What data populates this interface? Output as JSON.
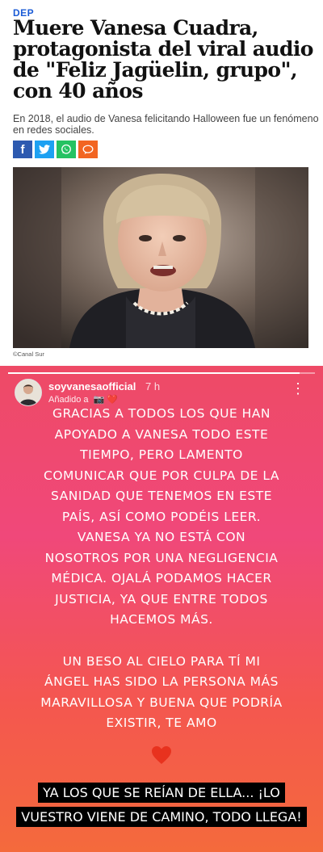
{
  "article": {
    "kicker": "DEP",
    "headline": "Muere Vanesa Cuadra, protagonista del viral audio de \"Feliz Jagüelin, grupo\", con 40 años",
    "subtitle": "En 2018, el audio de Vanesa felicitando Halloween fue un fenómeno en redes sociales.",
    "share_buttons": [
      {
        "icon": "facebook-icon",
        "glyph": "f"
      },
      {
        "icon": "twitter-icon",
        "glyph": ""
      },
      {
        "icon": "whatsapp-icon",
        "glyph": ""
      },
      {
        "icon": "comment-icon",
        "glyph": ""
      }
    ],
    "photo_credit": "©Canal Sur",
    "colors": {
      "kicker": "#1a5bd6",
      "facebook": "#2d5ab0",
      "twitter": "#1da1f2",
      "whatsapp": "#25c262",
      "comment": "#f26522"
    }
  },
  "story": {
    "username": "soyvanesaofficial",
    "time": "7 h",
    "added_label": "Añadido a",
    "progress": 0.95,
    "paragraph_1": "Gracias a todos los que han apoyado a Vanesa todo este tiempo, pero lamento comunicar que por culpa de la sanidad que tenemos en este país, así como podéis leer. Vanesa ya no está con nosotros por una negligencia médica. Ojalá podamos hacer justicia, ya que entre todos hacemos más.",
    "paragraph_2": "Un beso al cielo para tí mi ángel has sido la persona más maravillosa y buena que podría existir, te amo",
    "closing": "Ya los que se reían de ella... ¡Lo vuestro viene de camino, todo llega!",
    "colors": {
      "gradient_top": "#ee4a66",
      "gradient_bottom": "#f46a3c",
      "heart": "#e8321e"
    }
  }
}
